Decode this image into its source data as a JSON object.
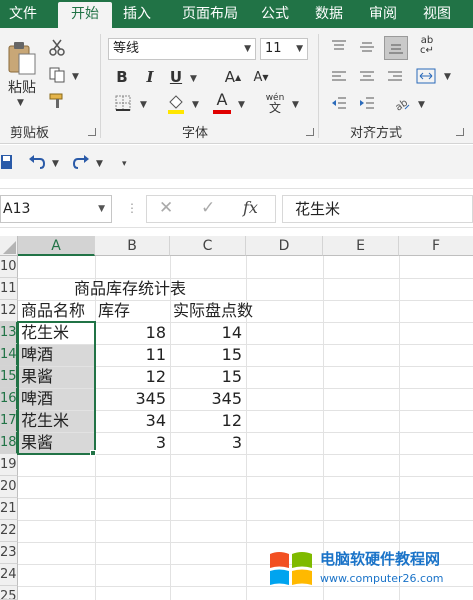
{
  "tabs": [
    {
      "label": "文件",
      "active": false
    },
    {
      "label": "开始",
      "active": true
    },
    {
      "label": "插入",
      "active": false
    },
    {
      "label": "页面布局",
      "active": false
    },
    {
      "label": "公式",
      "active": false
    },
    {
      "label": "数据",
      "active": false
    },
    {
      "label": "审阅",
      "active": false
    },
    {
      "label": "视图",
      "active": false
    }
  ],
  "ribbon": {
    "clipboard": {
      "label": "剪贴板",
      "paste_label": "粘贴"
    },
    "font": {
      "label": "字体",
      "font_name": "等线",
      "font_size": "11",
      "bold": "B",
      "italic": "I",
      "underline": "U",
      "grow": "A",
      "shrink": "A",
      "font_color_glyph": "A",
      "phonetic": "wén"
    },
    "alignment": {
      "label": "对齐方式"
    }
  },
  "formula_bar": {
    "name_box": "A13",
    "cancel": "✕",
    "enter": "✓",
    "fx": "fx",
    "value": "花生米"
  },
  "columns": [
    "A",
    "B",
    "C",
    "D",
    "E",
    "F"
  ],
  "rows": [
    "10",
    "11",
    "12",
    "13",
    "14",
    "15",
    "16",
    "17",
    "18",
    "19",
    "20",
    "21",
    "22",
    "23",
    "24",
    "25"
  ],
  "sheet": {
    "title": "商品库存统计表",
    "headers": [
      "商品名称",
      "库存",
      "实际盘点数"
    ],
    "records": [
      {
        "name": "花生米",
        "stock": "18",
        "count": "14"
      },
      {
        "name": "啤酒",
        "stock": "11",
        "count": "15"
      },
      {
        "name": "果酱",
        "stock": "12",
        "count": "15"
      },
      {
        "name": "啤酒",
        "stock": "345",
        "count": "345"
      },
      {
        "name": "花生米",
        "stock": "34",
        "count": "12"
      },
      {
        "name": "果酱",
        "stock": "3",
        "count": "3"
      }
    ]
  },
  "watermark": {
    "title": "电脑软硬件教程网",
    "url": "www.computer26.com"
  },
  "colors": {
    "accent": "#217346",
    "selection_fill": "#d8d8d8"
  }
}
